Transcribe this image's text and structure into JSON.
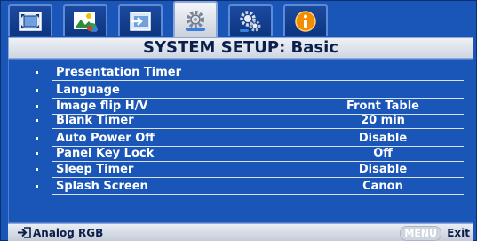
{
  "title": "SYSTEM SETUP: Basic",
  "tabs": [
    {
      "icon": "display-icon"
    },
    {
      "icon": "picture-icon"
    },
    {
      "icon": "source-icon"
    },
    {
      "icon": "system-setup-icon",
      "active": true
    },
    {
      "icon": "advanced-setup-icon"
    },
    {
      "icon": "information-icon"
    }
  ],
  "menu": {
    "items": [
      {
        "label": "Presentation Timer",
        "value": ""
      },
      {
        "label": "Language",
        "value": ""
      },
      {
        "label": "Image flip H/V",
        "value": "Front Table"
      },
      {
        "label": "Blank Timer",
        "value": "20 min"
      },
      {
        "label": "Auto Power Off",
        "value": "Disable"
      },
      {
        "label": "Panel Key Lock",
        "value": "Off"
      },
      {
        "label": "Sleep Timer",
        "value": "Disable"
      },
      {
        "label": "Splash Screen",
        "value": "Canon"
      }
    ]
  },
  "status": {
    "source": "Analog RGB",
    "menu_key": "MENU",
    "exit_label": "Exit"
  },
  "colors": {
    "background": "#1a56b8",
    "text": "#ffffff",
    "title_text": "#0b1f4a",
    "info_icon": "#f28c00"
  }
}
